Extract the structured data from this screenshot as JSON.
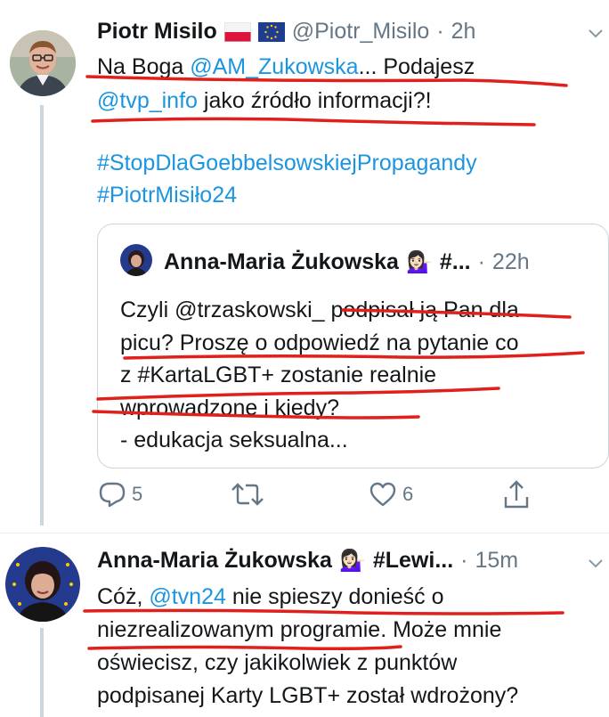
{
  "tweet1": {
    "author_name": "Piotr Misilo",
    "flags": [
      "poland-flag",
      "eu-flag"
    ],
    "handle": "@Piotr_Misilo",
    "sep": "·",
    "time": "2h",
    "line1_a": "Na Boga ",
    "line1_mention": "@AM_Zukowska",
    "line1_b": "... Podajesz",
    "line2_mention": "@tvp_info",
    "line2_b": " jako źródło informacji?!",
    "hashtag1": "#StopDlaGoebbelsowskiejPropagandy",
    "hashtag2": "#PiotrMisiło24",
    "actions": {
      "reply_count": "5",
      "retweet_count": "",
      "like_count": "6"
    },
    "menu_icon": "chevron-down-icon"
  },
  "quote": {
    "author_name": "Anna-Maria Żukowska",
    "emoji": "💁🏻‍♀️",
    "tag": "#...",
    "sep": "·",
    "time": "22h",
    "lines": [
      "Czyli @trzaskowski_ podpisał ją Pan dla",
      "picu? Proszę o odpowiedź na pytanie co",
      "z #KartaLGBT+ zostanie realnie",
      "wprowadzone i kiedy?",
      "- edukacja seksualna..."
    ]
  },
  "tweet2": {
    "author_name": "Anna-Maria Żukowska",
    "emoji": "💁🏻‍♀️",
    "tag": "#Lewi...",
    "sep": "·",
    "time": "15m",
    "line1_a": "Cóż, ",
    "line1_mention": "@tvn24",
    "line1_b": " nie spieszy donieść o",
    "line2": "niezrealizowanym programie. Może mnie",
    "line3": "oświecisz, czy jakikolwiek z punktów",
    "line4": "podpisanej Karty LGBT+ został wdrożony?",
    "menu_icon": "chevron-down-icon"
  },
  "colors": {
    "link": "#1b95e0",
    "muted": "#657786",
    "annotation_red": "#e0201b",
    "divider": "#ccd6dd"
  }
}
